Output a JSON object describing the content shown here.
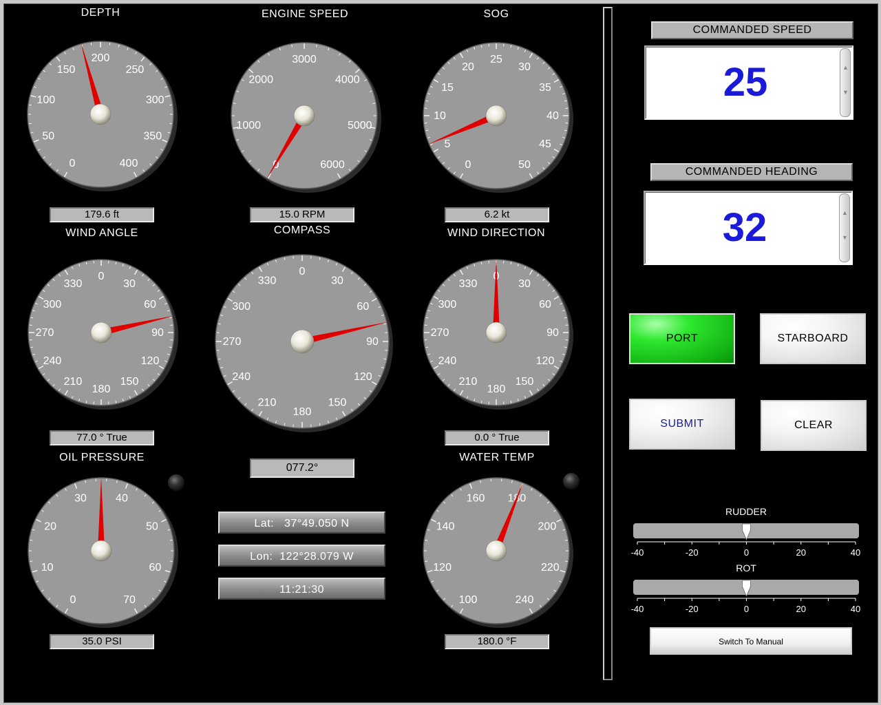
{
  "gauges": [
    {
      "id": "depth",
      "title": "DEPTH",
      "readout": "179.6 ft",
      "labels": [
        "0",
        "50",
        "100",
        "150",
        "200",
        "250",
        "300",
        "350",
        "400"
      ],
      "value": 179.6,
      "min": 0,
      "max": 400,
      "start_deg": 210,
      "sweep_deg": 300
    },
    {
      "id": "engine",
      "title": "ENGINE SPEED",
      "readout": "15.0 RPM",
      "labels": [
        "0",
        "1000",
        "2000",
        "3000",
        "4000",
        "5000",
        "6000"
      ],
      "value": 15,
      "min": 0,
      "max": 6000,
      "start_deg": 210,
      "sweep_deg": 300
    },
    {
      "id": "sog",
      "title": "SOG",
      "readout": "6.2 kt",
      "labels": [
        "0",
        "5",
        "10",
        "15",
        "20",
        "25",
        "30",
        "35",
        "40",
        "45",
        "50"
      ],
      "value": 6.2,
      "min": 0,
      "max": 50,
      "start_deg": 210,
      "sweep_deg": 300
    },
    {
      "id": "windangle",
      "title": "WIND ANGLE",
      "readout": "77.0 ° True",
      "labels": [
        "0",
        "30",
        "60",
        "90",
        "120",
        "150",
        "180",
        "210",
        "240",
        "270",
        "300",
        "330"
      ],
      "value": 77,
      "min": 0,
      "max": 360,
      "start_deg": 0,
      "sweep_deg": 360
    },
    {
      "id": "compass",
      "title": "COMPASS",
      "readout": "077.2°",
      "labels": [
        "0",
        "30",
        "60",
        "90",
        "120",
        "150",
        "180",
        "210",
        "240",
        "270",
        "300",
        "330"
      ],
      "value": 77.2,
      "min": 0,
      "max": 360,
      "start_deg": 0,
      "sweep_deg": 360
    },
    {
      "id": "winddir",
      "title": "WIND DIRECTION",
      "readout": "0.0 ° True",
      "labels": [
        "0",
        "30",
        "60",
        "90",
        "120",
        "150",
        "180",
        "210",
        "240",
        "270",
        "300",
        "330"
      ],
      "value": 0,
      "min": 0,
      "max": 360,
      "start_deg": 0,
      "sweep_deg": 360
    },
    {
      "id": "oil",
      "title": "OIL PRESSURE",
      "readout": "35.0 PSI",
      "labels": [
        "0",
        "10",
        "20",
        "30",
        "40",
        "50",
        "60",
        "70"
      ],
      "value": 35,
      "min": 0,
      "max": 70,
      "start_deg": 210,
      "sweep_deg": 300
    },
    {
      "id": "water",
      "title": "WATER TEMP",
      "readout": "180.0 °F",
      "labels": [
        "100",
        "120",
        "140",
        "160",
        "180",
        "200",
        "220",
        "240"
      ],
      "value": 180,
      "min": 100,
      "max": 240,
      "start_deg": 210,
      "sweep_deg": 300
    }
  ],
  "nav": {
    "lat_label": "Lat:",
    "lat_value": "37°49.050 N",
    "lon_label": "Lon:",
    "lon_value": "122°28.079 W",
    "time": "11:21:30"
  },
  "controls": {
    "commanded_speed_label": "COMMANDED SPEED",
    "commanded_speed_value": "25",
    "commanded_heading_label": "COMMANDED HEADING",
    "commanded_heading_value": "32",
    "port_label": "PORT",
    "starboard_label": "STARBOARD",
    "submit_label": "SUBMIT",
    "clear_label": "CLEAR",
    "manual_label": "Switch To Manual"
  },
  "sliders": [
    {
      "id": "rudder",
      "label": "RUDDER",
      "value": 0,
      "ticks": [
        "-40",
        "-20",
        "0",
        "20",
        "40"
      ]
    },
    {
      "id": "rot",
      "label": "ROT",
      "value": 0,
      "ticks": [
        "-40",
        "-20",
        "0",
        "20",
        "40"
      ]
    }
  ],
  "colors": {
    "needle": "#e00000",
    "dial_face": "#9a9a9a",
    "command_value": "#1a1ad8",
    "port_active": "#1dc81d"
  }
}
